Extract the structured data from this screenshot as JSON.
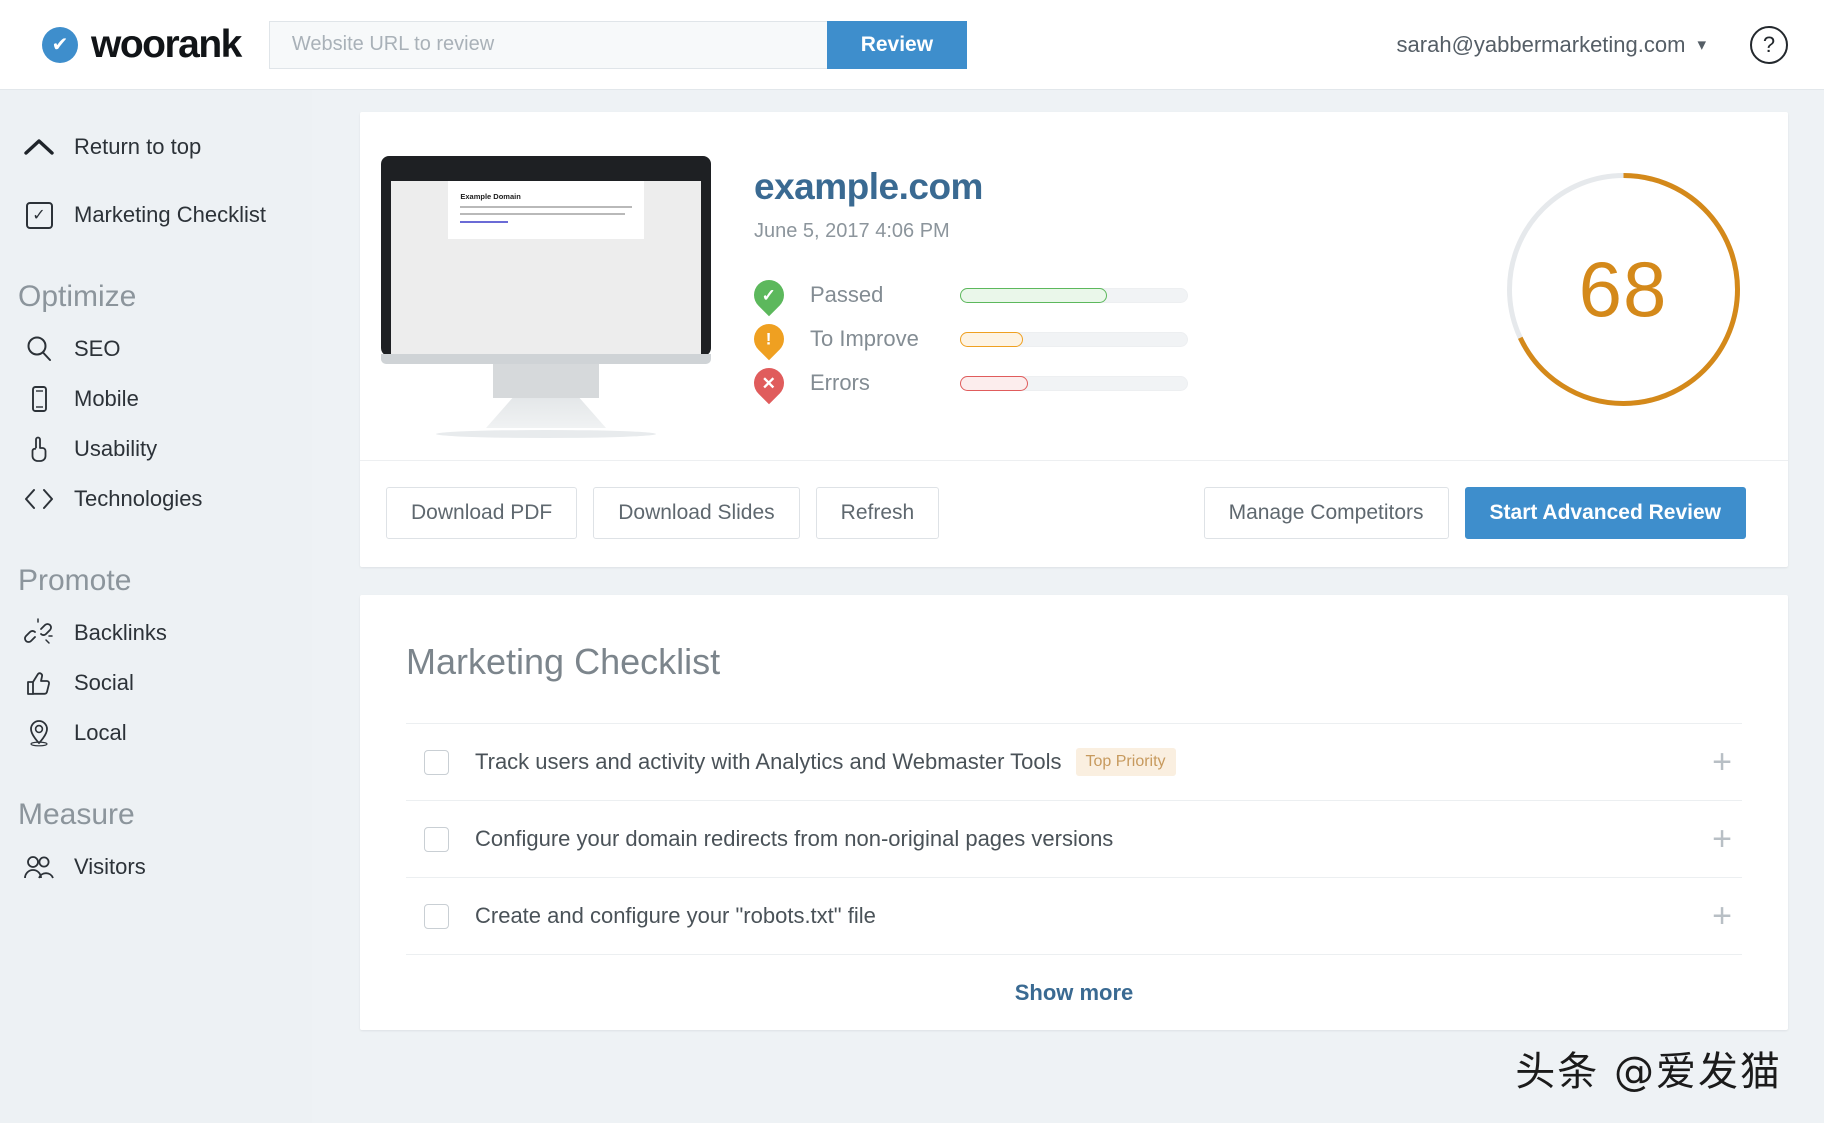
{
  "header": {
    "brand_name": "woorank",
    "brand_mark_icon": "check-badge-icon",
    "search_placeholder": "Website URL to review",
    "search_value": "",
    "review_label": "Review",
    "account_email": "sarah@yabbermarketing.com",
    "caret_icon": "chevron-down-icon",
    "help_icon": "question-mark-icon"
  },
  "sidebar": {
    "return_to_top": {
      "label": "Return to top",
      "icon": "chevron-up-icon"
    },
    "marketing_checklist": {
      "label": "Marketing Checklist",
      "icon": "checkbox-check-icon"
    },
    "groups": [
      {
        "title": "Optimize",
        "items": [
          {
            "label": "SEO",
            "icon": "magnifier-icon"
          },
          {
            "label": "Mobile",
            "icon": "phone-icon"
          },
          {
            "label": "Usability",
            "icon": "pointing-hand-icon"
          },
          {
            "label": "Technologies",
            "icon": "code-brackets-icon"
          }
        ]
      },
      {
        "title": "Promote",
        "items": [
          {
            "label": "Backlinks",
            "icon": "broken-link-icon"
          },
          {
            "label": "Social",
            "icon": "thumbs-up-icon"
          },
          {
            "label": "Local",
            "icon": "map-pin-icon"
          }
        ]
      },
      {
        "title": "Measure",
        "items": [
          {
            "label": "Visitors",
            "icon": "users-icon"
          }
        ]
      }
    ]
  },
  "overview": {
    "site_title": "example.com",
    "scan_date": "June 5, 2017 4:06 PM",
    "thumbnail": {
      "page_title": "Example Domain",
      "link_text": "More information..."
    },
    "stats": [
      {
        "name": "Passed",
        "icon": "check-circle-icon",
        "percent": 65,
        "color": "#5CB85C",
        "fill": "#EAF7EA"
      },
      {
        "name": "To Improve",
        "icon": "exclamation-circle-icon",
        "percent": 28,
        "color": "#EFA021",
        "fill": "#FDF3E3"
      },
      {
        "name": "Errors",
        "icon": "x-circle-icon",
        "percent": 30,
        "color": "#E05C5C",
        "fill": "#FCEDED"
      }
    ],
    "score": {
      "value": "68",
      "percent": 68,
      "color": "#D4891A",
      "track_color": "#E6E9EC"
    },
    "actions": {
      "left": [
        {
          "label": "Download PDF",
          "style": "secondary"
        },
        {
          "label": "Download Slides",
          "style": "secondary"
        },
        {
          "label": "Refresh",
          "style": "secondary"
        }
      ],
      "right": [
        {
          "label": "Manage Competitors",
          "style": "secondary"
        },
        {
          "label": "Start Advanced Review",
          "style": "primary"
        }
      ]
    }
  },
  "checklist": {
    "title": "Marketing Checklist",
    "items": [
      {
        "label": "Track users and activity with Analytics and Webmaster Tools",
        "badge": "Top Priority",
        "checked": false,
        "expand_icon": "plus-icon"
      },
      {
        "label": "Configure your domain redirects from non-original pages versions",
        "badge": "",
        "checked": false,
        "expand_icon": "plus-icon"
      },
      {
        "label": "Create and configure your \"robots.txt\" file",
        "badge": "",
        "checked": false,
        "expand_icon": "plus-icon"
      }
    ],
    "show_more_label": "Show more"
  },
  "watermark": {
    "text": "头条 @爱发猫"
  },
  "theme": {
    "brand_blue": "#3E8ECC",
    "score_orange": "#D4891A",
    "title_blue": "#3A6A92",
    "page_bg": "#EEF2F5",
    "sidebar_bg": "#EDF1F4"
  }
}
